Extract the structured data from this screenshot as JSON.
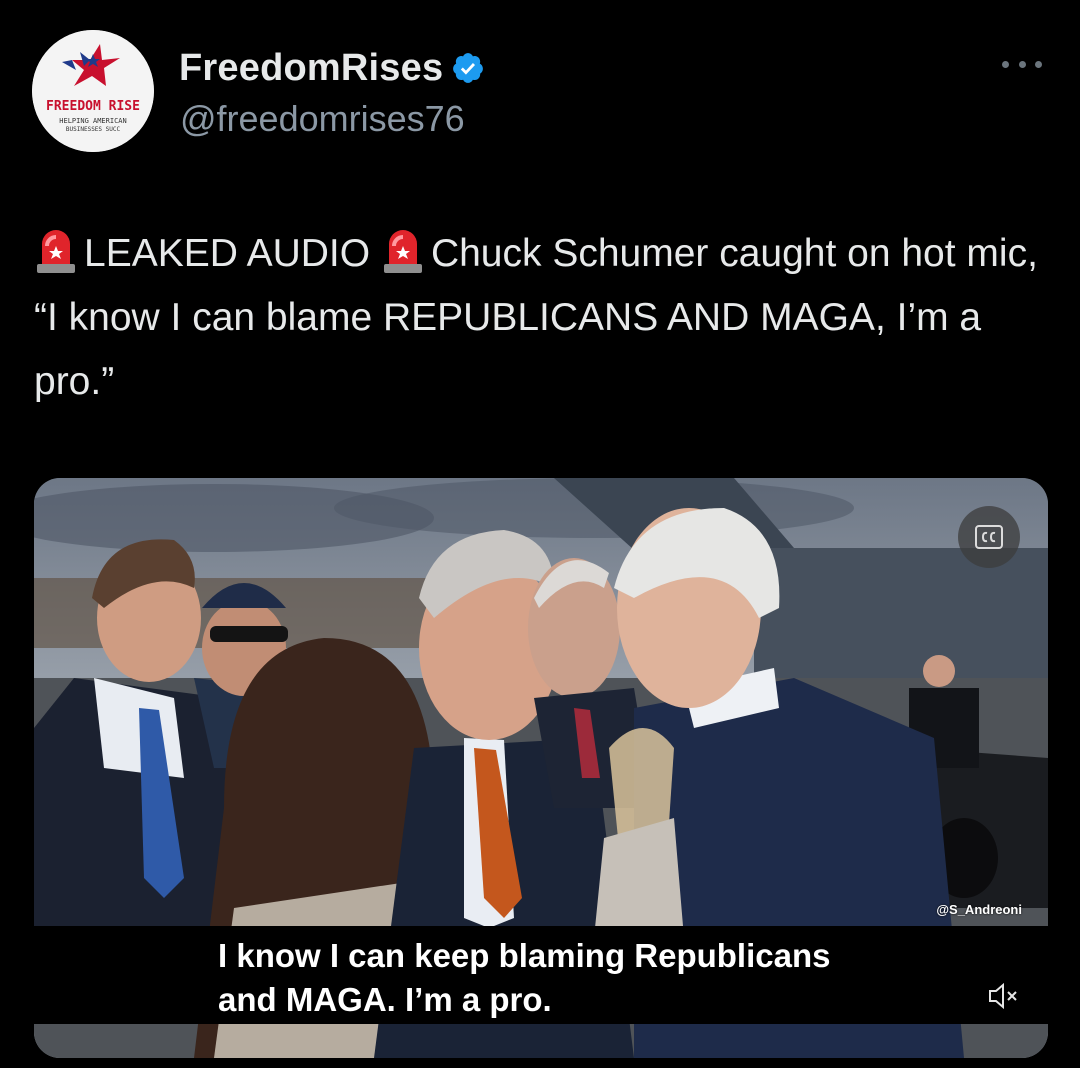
{
  "author": {
    "display_name": "FreedomRises",
    "handle": "@freedomrises76",
    "verified": true,
    "avatar_text_main": "FREEDOM RISE",
    "avatar_text_sub": "HELPING AMERICAN",
    "avatar_text_sub2": "BUSINESSES SUCC"
  },
  "tweet": {
    "segment_1": "LEAKED AUDIO",
    "segment_2": "Chuck Schumer caught on hot mic, “I know I can blame REPUBLICANS AND MAGA, I’m a pro.”",
    "emoji": "rotating-light-icon"
  },
  "media": {
    "caption_line_1": "I know I can keep blaming Republicans",
    "caption_line_2": "and MAGA. I’m a pro.",
    "watermark": "@S_Andreoni"
  },
  "colors": {
    "background": "#000000",
    "text": "#e7e9ea",
    "secondary_text": "#8b98a5",
    "verified_blue": "#1d9bf0"
  }
}
